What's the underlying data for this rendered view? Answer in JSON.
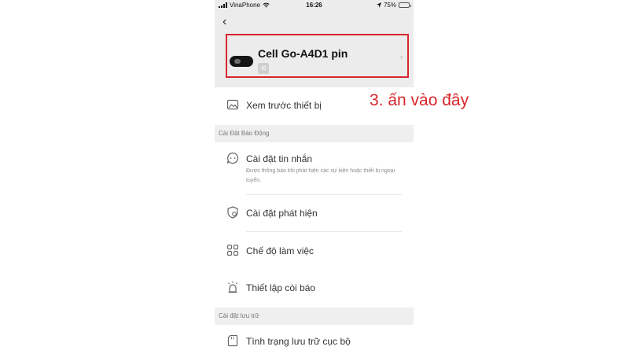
{
  "status_bar": {
    "carrier": "VinaPhone",
    "time": "16:26",
    "battery": "75%",
    "battery_level": 0.75
  },
  "header": {
    "device_name": "Cell Go-A4D1 pin"
  },
  "menu": {
    "preview": "Xem trước thiết bị",
    "alarm_section": "Cài Đặt Báo Động",
    "message_settings": "Cài đặt tin nhắn",
    "message_desc": "Được thông báo khi phát hiện các sự kiện hoặc thiết bị ngoại tuyến.",
    "detection_settings": "Cài đặt phát hiện",
    "work_mode": "Chế độ làm việc",
    "siren_setup": "Thiết lập còi báo",
    "storage_section": "Cài đặt lưu trữ",
    "local_storage": "Tình trạng lưu trữ cục bộ"
  },
  "annotation": "3. ấn vào đây",
  "colors": {
    "highlight": "#d9262b",
    "header_bg": "#ececec",
    "battery_fill": "#1fb24a"
  }
}
